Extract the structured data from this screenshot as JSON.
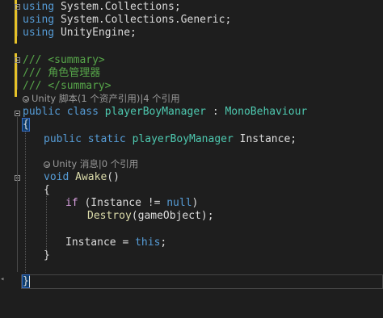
{
  "lines": {
    "l1": {
      "kw": "using",
      "rest": " System.Collections;"
    },
    "l2": {
      "kw": "using",
      "rest": " System.Collections.Generic;"
    },
    "l3": {
      "kw": "using",
      "rest": " UnityEngine;"
    },
    "l5": {
      "text": "/// <summary>"
    },
    "l6": {
      "text": "/// 角色管理器"
    },
    "l7": {
      "text": "/// </summary>"
    },
    "lens1": {
      "text": "Unity 脚本(1 个资产引用)|4 个引用"
    },
    "l8": {
      "kw1": "public",
      "kw2": " class ",
      "type1": "playerBoyManager",
      "colon": " : ",
      "type2": "MonoBehaviour"
    },
    "l9": {
      "brace": "{"
    },
    "l10": {
      "kw1": "public",
      "kw2": " static ",
      "type1": "playerBoyManager",
      "rest": " Instance;"
    },
    "lens2": {
      "text": "Unity 消息|0 个引用"
    },
    "l12": {
      "kw1": "void",
      "fn": " Awake",
      "rest": "()"
    },
    "l13": {
      "brace": "{"
    },
    "l14": {
      "ctl": "if",
      "rest": " (Instance != ",
      "kw": "null",
      "end": ")"
    },
    "l15": {
      "fn": "Destroy",
      "rest": "(gameObject);"
    },
    "l17": {
      "rest": "Instance = ",
      "kw": "this",
      "end": ";"
    },
    "l18": {
      "brace": "}"
    },
    "l20": {
      "brace": "}"
    }
  },
  "colors": {
    "background": "#1e1e1e",
    "keyword": "#569cd6",
    "control": "#d8a0df",
    "type": "#4ec9b0",
    "comment": "#57a64a",
    "method": "#dcdcaa",
    "text": "#dcdcdc",
    "codelens": "#9a9a9a"
  },
  "icons": {
    "fold": "collapse-minus-icon",
    "lens": "codelens-icon"
  }
}
